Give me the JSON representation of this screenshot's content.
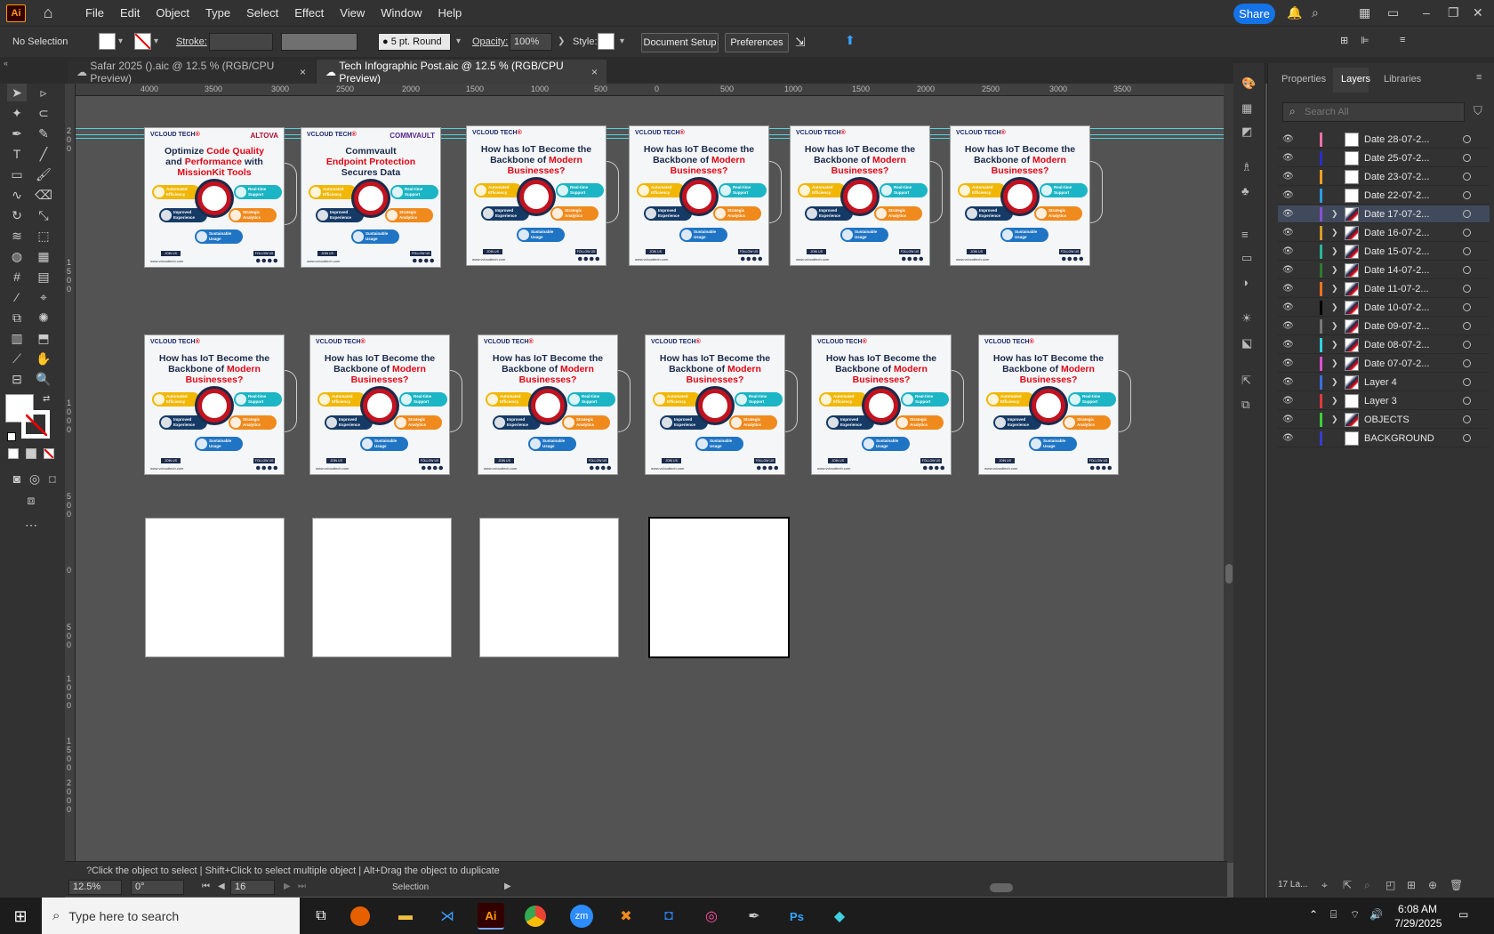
{
  "app": {
    "logo": "Ai",
    "menus": [
      "File",
      "Edit",
      "Object",
      "Type",
      "Select",
      "Effect",
      "View",
      "Window",
      "Help"
    ],
    "share_label": "Share"
  },
  "control": {
    "selection": "No Selection",
    "stroke_label": "Stroke:",
    "brush": "5 pt. Round",
    "opacity_label": "Opacity:",
    "opacity_value": "100%",
    "style_label": "Style:",
    "doc_setup": "Document Setup",
    "preferences": "Preferences"
  },
  "tabs": [
    {
      "label": "Safar 2025 ().aic @ 12.5 % (RGB/CPU Preview)",
      "close": "×"
    },
    {
      "label": "Tech Infographic Post.aic @ 12.5 % (RGB/CPU Preview)",
      "close": "×"
    }
  ],
  "ruler": {
    "h": [
      "4000",
      "3500",
      "3000",
      "2500",
      "2000",
      "1500",
      "1000",
      "500",
      "0",
      "500",
      "1000",
      "1500",
      "2000",
      "2500",
      "3000",
      "3500"
    ],
    "v": [
      "2\n0\n0",
      "1\n5\n0\n0",
      "1\n0\n0\n0",
      "5\n0\n0",
      "0",
      "5\n0\n0",
      "1\n0\n0\n0",
      "1\n5\n0\n0",
      "2\n0\n0\n0"
    ]
  },
  "artboards": {
    "brand_a": "VCLOUD TECH",
    "brand_b": "®",
    "iot_line1": "How has IoT Become the",
    "iot_line2": "Backbone of ",
    "iot_hl": "Modern",
    "iot_line3": "Businesses?",
    "altova_partner": "ALTOVA",
    "altova_line1": "Optimize ",
    "altova_hl1": "Code Quality",
    "altova_line2": "and ",
    "altova_hl2": "Performance",
    "altova_line3": " with",
    "altova_hl3": "MissionKit Tools",
    "comm_partner": "COMMVAULT",
    "comm_line1": "Commvault",
    "comm_hl": "Endpoint Protection",
    "comm_line2": "Secures Data",
    "join": "JOIN US",
    "follow": "FOLLOW US",
    "url": "www.vcloudtech.com",
    "pill1": "Automated Efficiency",
    "pill2": "Real-time Support",
    "pill3": "Improved Experience",
    "pill4": "Strategic Analytics",
    "pill5": "Sustainable Usage"
  },
  "panel": {
    "tabs": [
      "Properties",
      "Layers",
      "Libraries"
    ],
    "search_placeholder": "Search All",
    "layers": [
      {
        "name": "Date 28-07-2...",
        "color": "#f06fa8",
        "thumb": "white",
        "expand": false
      },
      {
        "name": "Date 25-07-2...",
        "color": "#2c2cc8",
        "thumb": "white",
        "expand": false
      },
      {
        "name": "Date 23-07-2...",
        "color": "#f5a020",
        "thumb": "white",
        "expand": false
      },
      {
        "name": "Date 22-07-2...",
        "color": "#2b9be0",
        "thumb": "white",
        "expand": false
      },
      {
        "name": "Date 17-07-2...",
        "color": "#8a4fd6",
        "thumb": "img",
        "expand": true
      },
      {
        "name": "Date 16-07-2...",
        "color": "#d69a2b",
        "thumb": "img",
        "expand": true
      },
      {
        "name": "Date 15-07-2...",
        "color": "#2bb39a",
        "thumb": "img",
        "expand": true
      },
      {
        "name": "Date 14-07-2...",
        "color": "#2f7a2f",
        "thumb": "img",
        "expand": true
      },
      {
        "name": "Date 11-07-2...",
        "color": "#f07020",
        "thumb": "img",
        "expand": true
      },
      {
        "name": "Date 10-07-2...",
        "color": "#000000",
        "thumb": "img",
        "expand": true
      },
      {
        "name": "Date 09-07-2...",
        "color": "#777777",
        "thumb": "img",
        "expand": true
      },
      {
        "name": "Date 08-07-2...",
        "color": "#2fd3e0",
        "thumb": "img",
        "expand": true
      },
      {
        "name": "Date 07-07-2...",
        "color": "#e04fd0",
        "thumb": "img",
        "expand": true
      },
      {
        "name": "Layer 4",
        "color": "#3a6fe0",
        "thumb": "img",
        "expand": true
      },
      {
        "name": "Layer 3",
        "color": "#e03a3a",
        "thumb": "white",
        "expand": true
      },
      {
        "name": "OBJECTS",
        "color": "#3ad03a",
        "thumb": "img",
        "expand": true
      },
      {
        "name": "BACKGROUND",
        "color": "#3a3ad0",
        "thumb": "white",
        "expand": false
      }
    ],
    "footer": "17 La..."
  },
  "status": {
    "hint": "Click the object to select  |  Shift+Click to select multiple object  |  Alt+Drag the object to duplicate",
    "zoom": "12.5%",
    "rotate": "0°",
    "artboard": "16",
    "tool": "Selection"
  },
  "taskbar": {
    "search": "Type here to search",
    "time": "6:08 AM",
    "date": "7/29/2025"
  }
}
